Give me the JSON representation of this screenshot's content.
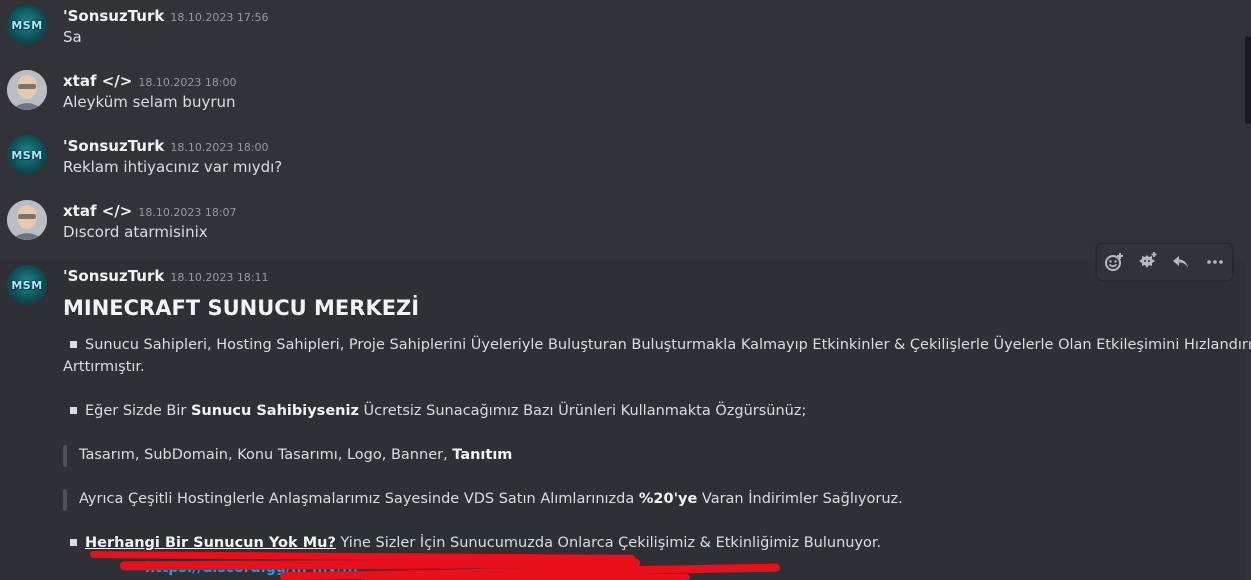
{
  "messages": [
    {
      "user": "'SonsuzTurk",
      "time": "18.10.2023 17:56",
      "text": "Sa",
      "avatar": "msm"
    },
    {
      "user": "xtaf </>",
      "time": "18.10.2023 18:00",
      "text": "Aleyküm selam buyrun",
      "avatar": "photo"
    },
    {
      "user": "'SonsuzTurk",
      "time": "18.10.2023 18:00",
      "text": "Reklam ihtiyacınız var mıydı?",
      "avatar": "msm"
    },
    {
      "user": "xtaf </>",
      "time": "18.10.2023 18:07",
      "text": "Dıscord atarmisinix",
      "avatar": "photo"
    },
    {
      "user": "'SonsuzTurk",
      "time": "18.10.2023 18:11",
      "avatar": "msm"
    }
  ],
  "avatar_text": "MSM",
  "post": {
    "title": "MINECRAFT SUNUCU MERKEZİ",
    "p1a": "Sunucu Sahipleri, Hosting Sahipleri, Proje Sahiplerini Üyeleriyle Buluşturan Buluşturmakla Kalmayıp Etkinkinler & Çekilişlerle Üyelerle Olan Etkileşimini Hızlandırıp",
    "p1b": "Arttırmıştır.",
    "p2_pre": "Eğer Sizde Bir ",
    "p2_bold": "Sunucu Sahibiyseniz",
    "p2_post": " Ücretsiz Sunacağımız Bazı Ürünleri Kullanmakta Özgürsünüz;",
    "q1_pre": "Tasarım, SubDomain, Konu Tasarımı, Logo, Banner, ",
    "q1_bold": "Tanıtım",
    "q2_pre": "Ayrıca Çeşitli Hostinglerle Anlaşmalarımız Sayesinde VDS Satın Alımlarınızda ",
    "q2_bold": "%20'ye",
    "q2_post": " Varan İndirimler Sağlıyoruz.",
    "p3_bold": "Herhangi Bir Sunucun Yok Mu?",
    "p3_post": " Yine Sizler İçin Sunucumuzda Onlarca Çekilişimiz & Etkinliğimiz Bulunuyor.",
    "link_partial": "https://discord.gg/... ...v/..."
  },
  "toolbar": [
    "add-reaction",
    "add-super-reaction",
    "reply",
    "more"
  ],
  "colors": {
    "background": "#313338",
    "username": "#f2f3f5",
    "timestamp": "#949ba4",
    "text": "#dbdee1",
    "redact": "#e8101a"
  }
}
